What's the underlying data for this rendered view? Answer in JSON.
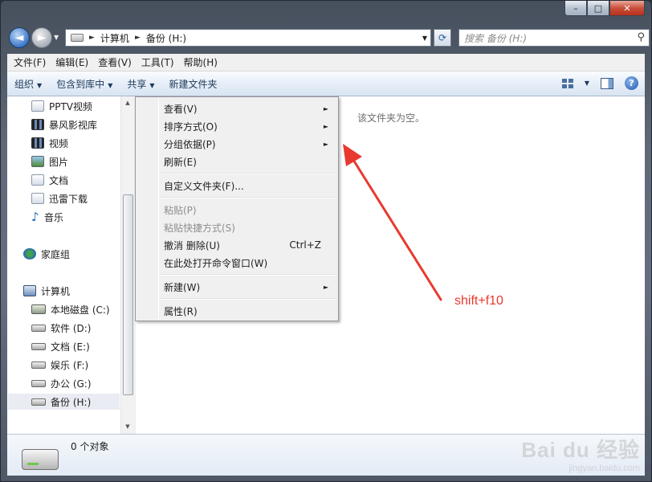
{
  "window": {
    "min_label": "–",
    "max_label": "□",
    "close_label": "✕"
  },
  "nav": {
    "back_label": "◄",
    "forward_label": "►",
    "dropdown_label": "▼"
  },
  "address": {
    "separator": "►",
    "crumbs": [
      "计算机",
      "备份 (H:)"
    ],
    "dropdown_label": "▼",
    "refresh_label": "⟳"
  },
  "search": {
    "placeholder": "搜索 备份 (H:)",
    "icon_label": "⚲"
  },
  "menubar": [
    "文件(F)",
    "编辑(E)",
    "查看(V)",
    "工具(T)",
    "帮助(H)"
  ],
  "commands": {
    "organize": "组织",
    "include_library": "包含到库中",
    "share": "共享",
    "new_folder": "新建文件夹",
    "caret": "▼",
    "help_label": "?"
  },
  "nav_pane": {
    "libraries": [
      {
        "label": "PPTV视频",
        "icon": "document-icon"
      },
      {
        "label": "暴风影视库",
        "icon": "film-icon"
      },
      {
        "label": "视频",
        "icon": "video-icon"
      },
      {
        "label": "图片",
        "icon": "picture-icon"
      },
      {
        "label": "文档",
        "icon": "document-icon"
      },
      {
        "label": "迅雷下载",
        "icon": "document-icon"
      },
      {
        "label": "音乐",
        "icon": "music-icon"
      }
    ],
    "homegroup": "家庭组",
    "computer": "计算机",
    "drives": [
      {
        "label": "本地磁盘 (C:)"
      },
      {
        "label": "软件 (D:)"
      },
      {
        "label": "文档 (E:)"
      },
      {
        "label": "娱乐 (F:)"
      },
      {
        "label": "办公 (G:)"
      },
      {
        "label": "备份 (H:)"
      }
    ],
    "selected": "备份 (H:)"
  },
  "scrollbar": {
    "up": "▲",
    "down": "▼",
    "grip": "≡"
  },
  "content": {
    "empty_message": "该文件夹为空。"
  },
  "context_menu": {
    "items": [
      {
        "label": "查看(V)",
        "submenu": true
      },
      {
        "label": "排序方式(O)",
        "submenu": true
      },
      {
        "label": "分组依据(P)",
        "submenu": true
      },
      {
        "label": "刷新(E)"
      },
      {
        "label": "自定义文件夹(F)..."
      },
      {
        "label": "粘贴(P)",
        "disabled": true
      },
      {
        "label": "粘贴快捷方式(S)",
        "disabled": true
      },
      {
        "label": "撤消 删除(U)",
        "shortcut": "Ctrl+Z"
      },
      {
        "label": "在此处打开命令窗口(W)"
      },
      {
        "label": "新建(W)",
        "submenu": true
      },
      {
        "label": "属性(R)"
      }
    ],
    "submenu_arrow": "►"
  },
  "annotation": {
    "text": "shift+f10",
    "color": "#e8392f"
  },
  "details": {
    "item_count": "0 个对象"
  },
  "watermark": {
    "logo": "Bai du 经验",
    "url": "jingyan.baidu.com"
  }
}
